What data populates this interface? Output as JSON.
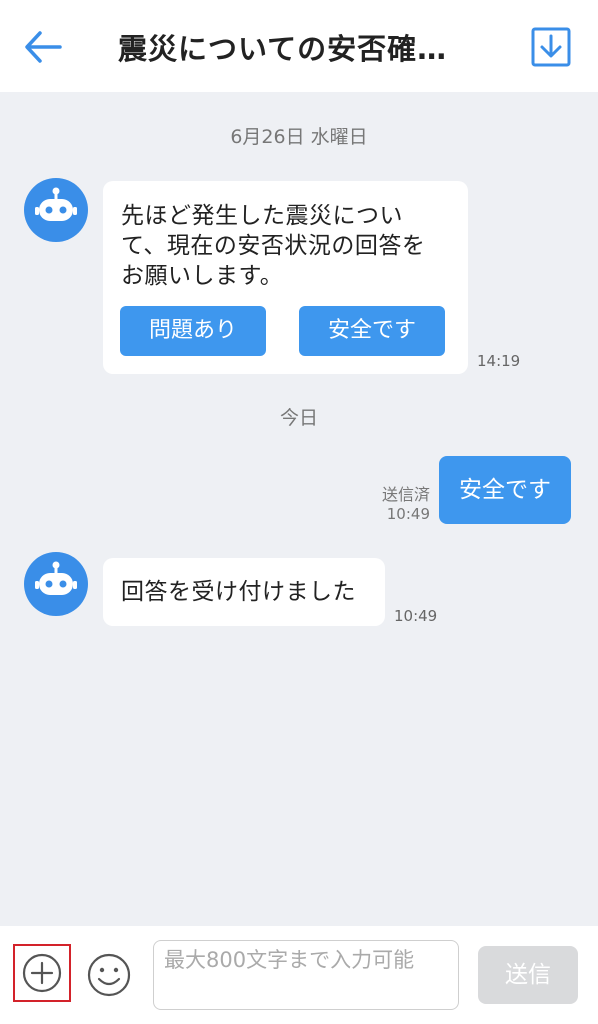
{
  "header": {
    "title": "震災についての安否確…",
    "back_icon": "arrow-left-icon",
    "download_icon": "download-icon",
    "accent_color": "#3a8ee8"
  },
  "chat": {
    "date_separators": [
      "6月26日 水曜日",
      "今日"
    ],
    "messages": [
      {
        "from": "bot",
        "text_lines": [
          "先ほど発生した震災につい",
          "て、現在の安否状況の回答を",
          "お願いします。"
        ],
        "buttons": [
          "問題あり",
          "安全です"
        ],
        "time": "14:19"
      },
      {
        "from": "me",
        "text": "安全です",
        "status": "送信済",
        "time": "10:49"
      },
      {
        "from": "bot",
        "text": "回答を受け付けました",
        "time": "10:49"
      }
    ]
  },
  "composer": {
    "placeholder": "最大800文字まで入力可能",
    "send_label": "送信",
    "plus_icon": "plus-circle-icon",
    "emoji_icon": "smiley-icon"
  }
}
